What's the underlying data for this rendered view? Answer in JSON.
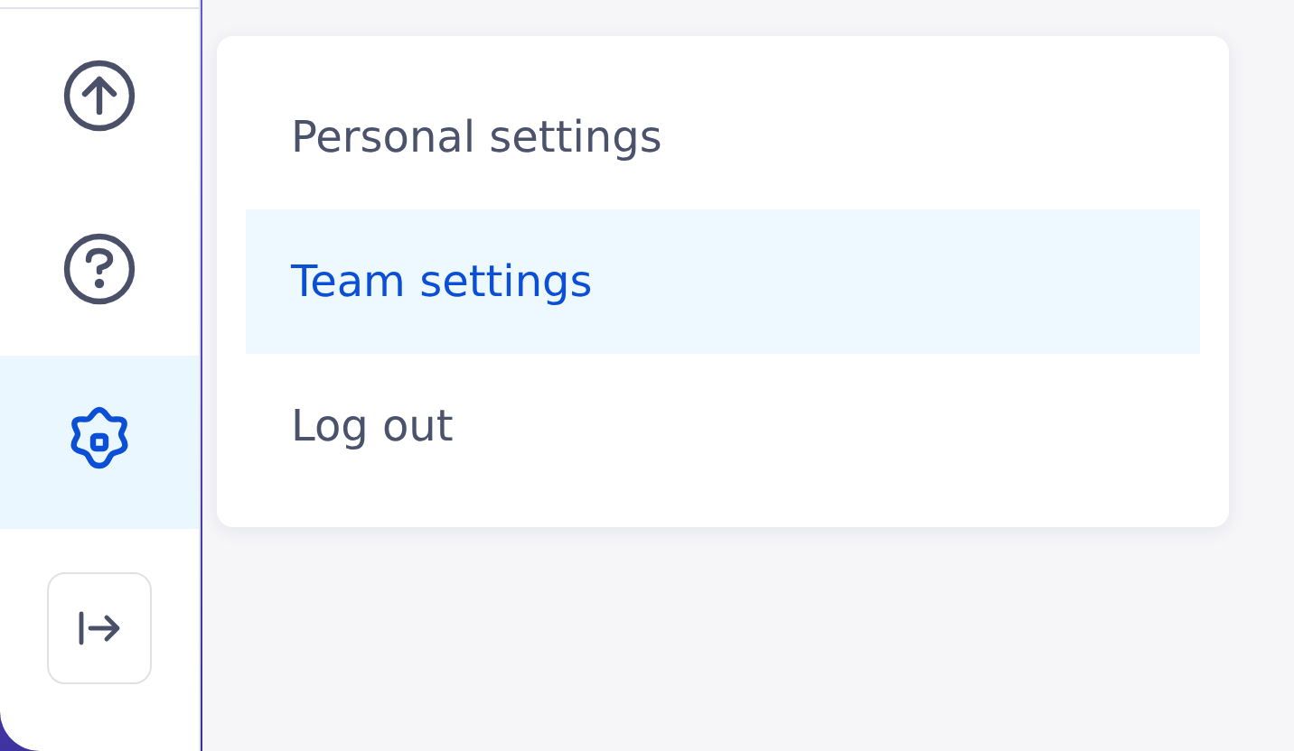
{
  "sidebar": {
    "items": [
      {
        "kind": "upload",
        "selected": false
      },
      {
        "kind": "help",
        "selected": false
      },
      {
        "kind": "settings",
        "selected": true
      }
    ]
  },
  "menu": {
    "items": [
      {
        "label": "Personal settings",
        "selected": false
      },
      {
        "label": "Team settings",
        "selected": true
      },
      {
        "label": "Log out",
        "selected": false
      }
    ]
  }
}
